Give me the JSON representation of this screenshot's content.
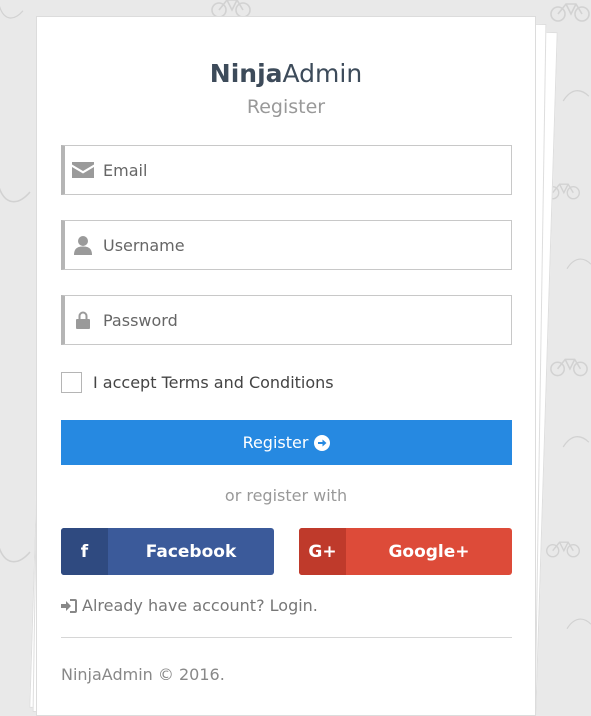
{
  "brand": {
    "bold": "Ninja",
    "light": "Admin"
  },
  "subtitle": "Register",
  "fields": {
    "email_placeholder": "Email",
    "username_placeholder": "Username",
    "password_placeholder": "Password"
  },
  "terms_label": "I accept Terms and Conditions",
  "register_button": "Register",
  "or_text": "or register with",
  "social": {
    "facebook_icon": "f",
    "facebook_label": "Facebook",
    "google_icon": "G+",
    "google_label": "Google+"
  },
  "login_link": "Already have account? Login.",
  "footer": "NinjaAdmin © 2016.",
  "colors": {
    "primary": "#2689e1",
    "facebook": "#3b5a9a",
    "google": "#dd4b39",
    "brand_text": "#3d4b5a"
  },
  "icons": [
    "envelope-icon",
    "user-icon",
    "lock-icon",
    "arrow-circle-right-icon",
    "sign-in-icon"
  ]
}
